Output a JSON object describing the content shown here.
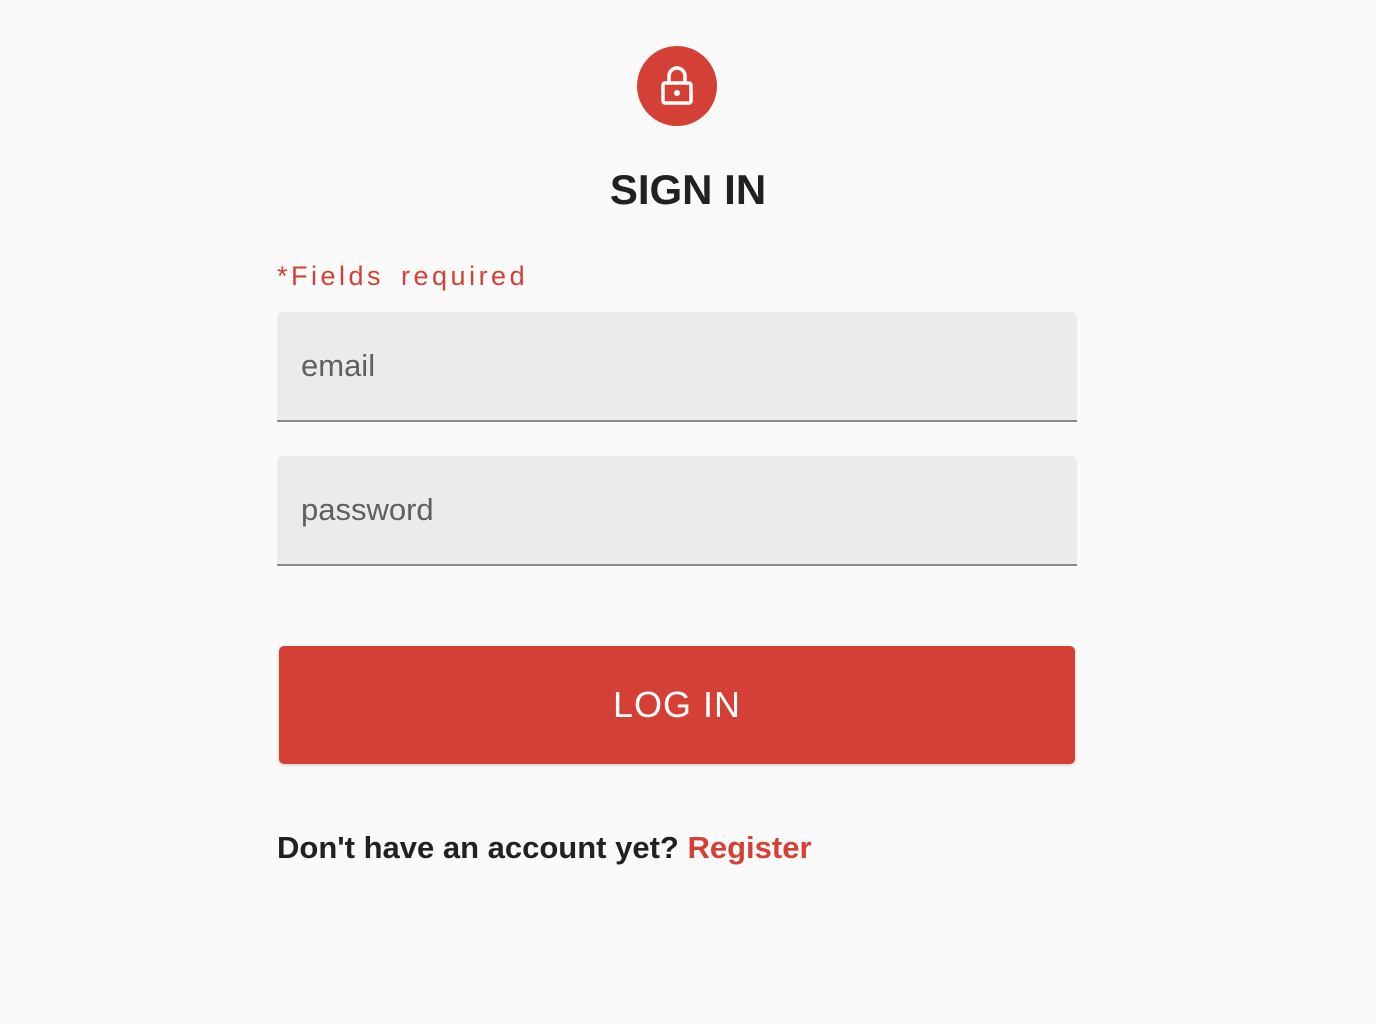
{
  "header": {
    "icon": "lock-icon",
    "title": "SIGN IN"
  },
  "form": {
    "required_note": "*Fields required",
    "email": {
      "placeholder": "email",
      "value": ""
    },
    "password": {
      "placeholder": "password",
      "value": ""
    },
    "submit_label": "LOG IN"
  },
  "footer": {
    "prompt": "Don't have an account yet?",
    "link": "Register"
  },
  "colors": {
    "accent": "#d54036",
    "background": "#fafafa",
    "field": "#ebebeb"
  }
}
